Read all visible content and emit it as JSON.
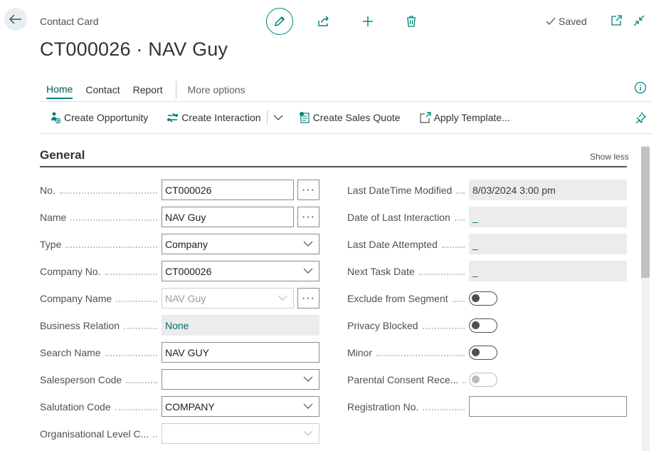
{
  "header": {
    "card_label": "Contact Card",
    "title": "CT000026 · NAV Guy",
    "saved_label": "Saved"
  },
  "tabs": [
    {
      "label": "Home",
      "active": true
    },
    {
      "label": "Contact"
    },
    {
      "label": "Report"
    },
    {
      "label": "More options"
    }
  ],
  "actions": {
    "create_opportunity": "Create Opportunity",
    "create_interaction": "Create Interaction",
    "create_sales_quote": "Create Sales Quote",
    "apply_template": "Apply Template..."
  },
  "section": {
    "title": "General",
    "show_less": "Show less"
  },
  "left_fields": {
    "no": {
      "label": "No.",
      "value": "CT000026"
    },
    "name": {
      "label": "Name",
      "value": "NAV Guy"
    },
    "type": {
      "label": "Type",
      "value": "Company"
    },
    "company_no": {
      "label": "Company No.",
      "value": "CT000026"
    },
    "company_name": {
      "label": "Company Name",
      "value": "NAV Guy"
    },
    "business_relation": {
      "label": "Business Relation",
      "value": "None"
    },
    "search_name": {
      "label": "Search Name",
      "value": "NAV GUY"
    },
    "salesperson_code": {
      "label": "Salesperson Code",
      "value": ""
    },
    "salutation_code": {
      "label": "Salutation Code",
      "value": "COMPANY"
    },
    "org_level": {
      "label": "Organisational Level C...",
      "value": ""
    }
  },
  "right_fields": {
    "last_modified": {
      "label": "Last DateTime Modified",
      "value": "8/03/2024 3:00 pm"
    },
    "last_interaction": {
      "label": "Date of Last Interaction",
      "value": "_"
    },
    "last_attempted": {
      "label": "Last Date Attempted",
      "value": "_"
    },
    "next_task": {
      "label": "Next Task Date",
      "value": "_"
    },
    "exclude_segment": {
      "label": "Exclude from Segment"
    },
    "privacy_blocked": {
      "label": "Privacy Blocked"
    },
    "minor": {
      "label": "Minor"
    },
    "parental_consent": {
      "label": "Parental Consent Rece..."
    },
    "registration_no": {
      "label": "Registration No.",
      "value": ""
    }
  },
  "dots_label": "···",
  "colors": {
    "accent": "#00837a",
    "readonly_bg": "#ececec",
    "link_text": "#00696d"
  }
}
